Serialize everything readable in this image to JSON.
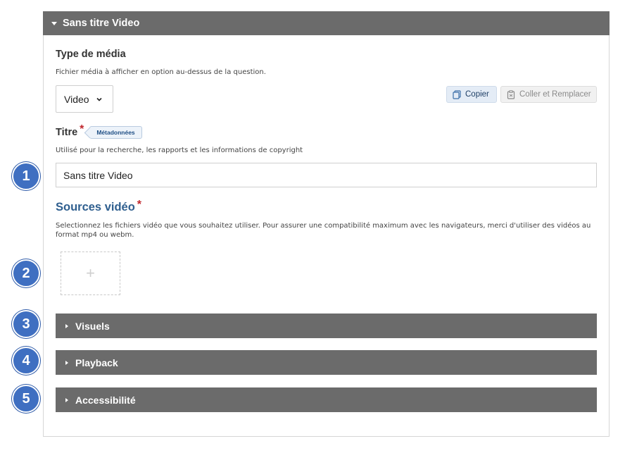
{
  "header": {
    "title": "Sans titre Video"
  },
  "media_type": {
    "label": "Type de média",
    "description": "Fichier média à afficher en option au-dessus de la question.",
    "selected": "Video"
  },
  "toolbar": {
    "copy_label": "Copier",
    "paste_label": "Coller et Remplacer"
  },
  "title_field": {
    "label": "Titre",
    "required_mark": "*",
    "meta_tag": "Métadonnées",
    "description": "Utilisé pour la recherche, les rapports et les informations de copyright",
    "value": "Sans titre Video"
  },
  "sources": {
    "label": "Sources vidéo",
    "required_mark": "*",
    "description": "Selectionnez les fichiers vidéo que vous souhaitez utiliser. Pour assurer une compatibilité maximum avec les navigateurs, merci d'utiliser des vidéos au format mp4 ou webm.",
    "add_symbol": "+"
  },
  "groups": [
    {
      "label": "Visuels"
    },
    {
      "label": "Playback"
    },
    {
      "label": "Accessibilité"
    }
  ],
  "callouts": [
    "1",
    "2",
    "3",
    "4",
    "5"
  ],
  "colors": {
    "header_bg": "#6b6b6b",
    "callout": "#3f6fc1",
    "sources_label": "#2f5f8f",
    "required": "#c0272d"
  }
}
